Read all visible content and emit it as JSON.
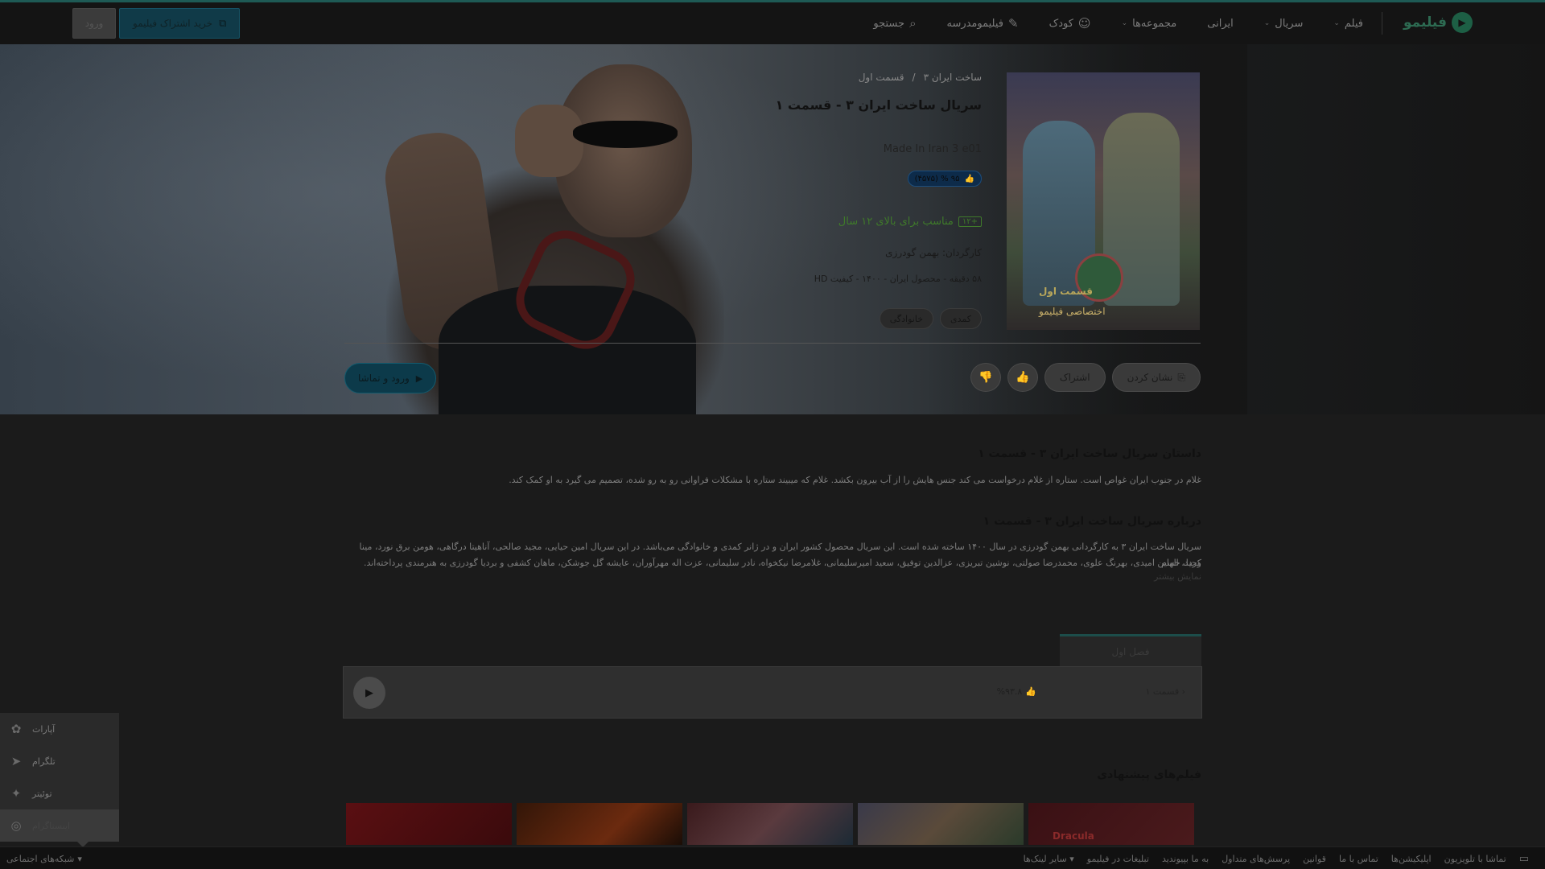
{
  "header": {
    "logo_text": "فیلیمو",
    "nav": [
      {
        "label": "فیلم",
        "has_dropdown": true
      },
      {
        "label": "سریال",
        "has_dropdown": true
      },
      {
        "label": "ایرانی",
        "has_dropdown": false
      },
      {
        "label": "مجموعه‌ها",
        "has_dropdown": true
      },
      {
        "label": "کودک",
        "icon": "kid-icon"
      },
      {
        "label": "فیلیمومدرسه",
        "icon": "school-icon"
      },
      {
        "label": "جستجو",
        "icon": "search-icon"
      }
    ],
    "subscribe_label": "خرید اشتراک فیلیمو",
    "login_label": "ورود"
  },
  "hero": {
    "breadcrumb": [
      "ساخت ایران ۳",
      "/",
      "قسمت اول"
    ],
    "title": "سریال ساخت ایران ۳ - قسمت ۱",
    "title_en": "Made In Iran 3 e01",
    "rating": "۹۵ %  (۴۵۷۵)",
    "age_badge": "+۱۲",
    "age_text": "مناسب برای بالای ۱۲ سال",
    "director": "کارگردان: بهمن گودرزی",
    "meta": "۵۸ دقیقه - محصول ایران - ۱۴۰۰ - کیفیت HD",
    "tags": [
      "کمدی",
      "خانوادگی"
    ],
    "actions": {
      "bookmark": "نشان کردن",
      "share": "اشتراک",
      "watch": "ورود و تماشا"
    },
    "poster": {
      "title": "قسمت اول",
      "brand": "اختصاصی فیلیمو"
    }
  },
  "story": {
    "title": "داستان سریال ساخت ایران ۳ - قسمت ۱",
    "text": "غلام در جنوب ایران غواص است. ستاره از غلام درخواست می کند جنس هایش را از آب بیرون بکشد. غلام که میبیند ستاره با مشکلات فراوانی رو به رو شده، تصمیم می گیرد به او کمک کند."
  },
  "about": {
    "title": "درباره سریال ساخت ایران ۳ - قسمت ۱",
    "line1": "سریال ساخت ایران ۳ به کارگردانی بهمن گودرزی در سال ۱۴۰۰ ساخته شده است. این سریال محصول کشور ایران و در ژانر کمدی و خانوادگی می‌باشد. در این سریال امین حیایی، مجید صالحی، آناهیتا درگاهی، هومن برق نورد، مینا وحید، الهام",
    "line2": "کردا، حسین امیدی، بهرنگ علوی، محمدرضا صولتی، نوشین تبریزی، عزالدین توفیق، سعید امیرسلیمانی، غلامرضا نیکخواه، نادر سلیمانی، عزت اله مهرآوران، عایشه گل جوشکن، ماهان کشفی و بردیا گودرزی به هنرمندی پرداخته‌اند.",
    "more": "نمایش بیشتر"
  },
  "seasons": {
    "tab": "فصل اول",
    "episode_name": "قسمت ۱",
    "episode_score": "%۹۳.۸"
  },
  "suggest": {
    "title": "فیلم‌های پیشنهادی",
    "items": [
      "thumb-1",
      "thumb-2",
      "thumb-3",
      "thumb-4",
      "Dracula"
    ]
  },
  "social": [
    {
      "label": "آپارات",
      "icon": "aparat-icon"
    },
    {
      "label": "تلگرام",
      "icon": "telegram-icon"
    },
    {
      "label": "توئیتر",
      "icon": "twitter-icon"
    },
    {
      "label": "اینستاگرام",
      "icon": "instagram-icon"
    }
  ],
  "footer": {
    "links": [
      "تماشا با تلویزیون",
      "اپلیکیشن‌ها",
      "تماس با ما",
      "قوانین",
      "پرسش‌های متداول",
      "به ما بپیوندید",
      "تبلیغات در فیلیمو",
      "سایر لینک‌ها"
    ],
    "social_toggle": "شبکه‌های اجتماعی"
  },
  "colors": {
    "accent": "#1e5a55",
    "subscribe": "#103a48",
    "age_green": "#3f7a2a",
    "rating_blue": "#0d2b4a"
  }
}
